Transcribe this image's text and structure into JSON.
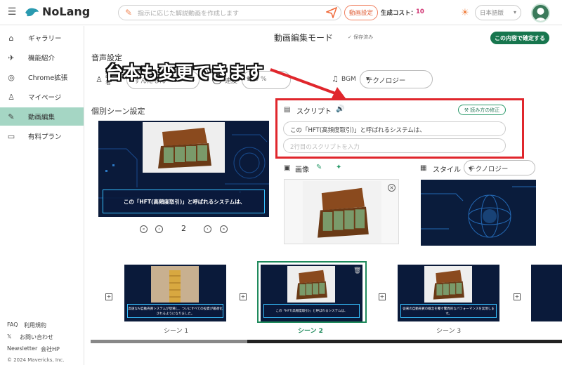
{
  "app": {
    "name": "NoLang"
  },
  "header": {
    "prompt_placeholder": "指示に応じた解説動画を作成します",
    "video_settings": "動画設定",
    "cost_label": "生成コスト：",
    "cost_value": "10",
    "language": "日本語版"
  },
  "sidebar": {
    "items": [
      {
        "label": "ギャラリー",
        "icon": "home-icon"
      },
      {
        "label": "機能紹介",
        "icon": "rocket-icon"
      },
      {
        "label": "Chrome拡張",
        "icon": "chrome-icon"
      },
      {
        "label": "マイページ",
        "icon": "user-icon"
      },
      {
        "label": "動画編集",
        "icon": "pencil-icon",
        "active": true
      },
      {
        "label": "有料プラン",
        "icon": "card-icon"
      }
    ],
    "footer": {
      "faq": "FAQ",
      "terms": "利用規約",
      "contact": "お問い合わせ",
      "newsletter": "Newsletter",
      "company": "会社HP",
      "copyright": "© 2024 Mavericks, Inc."
    }
  },
  "main": {
    "mode_title": "動画編集モード",
    "saved": "保存済み",
    "confirm": "この内容で確定する",
    "audio_heading": "音声設定",
    "narrator_label": "話者",
    "narrator_value": "ずんだもん",
    "speed_label": "速度",
    "speed_value": "100 %",
    "bgm_label": "BGM",
    "bgm_value": "テクノロジー",
    "annotation": "台本も変更できます",
    "scene_heading": "個別シーン設定",
    "preview_caption": "この「HFT(高頻度取引)」と呼ばれるシステムは、",
    "page": "2",
    "script_label": "スクリプト",
    "fix_reading": "読み方の修正",
    "script_line1": "この「HFT(高頻度取引)」と呼ばれるシステムは、",
    "script_line2_placeholder": "2行目のスクリプトを入力",
    "image_label": "画像",
    "style_label": "スタイル",
    "style_value": "テクノロジー"
  },
  "timeline": {
    "scenes": [
      {
        "label": "シーン 1",
        "caption": "高速なAI自動売買システムが登場し、ついにすべての投資が最適化されるようになりました。"
      },
      {
        "label": "シーン 2",
        "caption": "この「HFT(高頻度取引)」と呼ばれるシステムは、"
      },
      {
        "label": "シーン 3",
        "caption": "従来の自動売買の概念を覆す驚異的なパフォーマンスを実現します。"
      }
    ]
  },
  "colors": {
    "accent": "#17764e",
    "active_nav": "#a5d6c4",
    "annotation_box": "#e0262c",
    "brand_orange": "#f06a3a"
  }
}
